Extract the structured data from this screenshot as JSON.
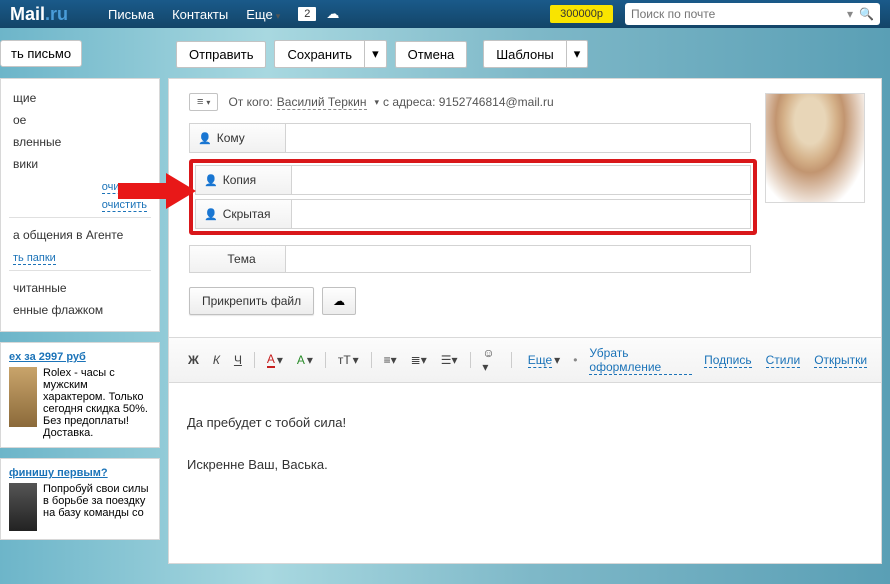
{
  "topnav": {
    "logo_a": "Mail",
    "logo_b": ".ru",
    "links": [
      "Письма",
      "Контакты",
      "Еще"
    ],
    "notif_count": "2",
    "money": "300000р",
    "search_placeholder": "Поиск по почте"
  },
  "toolbar": {
    "write": "ть письмо",
    "send": "Отправить",
    "save": "Сохранить",
    "cancel": "Отмена",
    "templates": "Шаблоны"
  },
  "sidebar": {
    "folders": [
      "щие",
      "ое",
      "вленные",
      "вики"
    ],
    "clear": "очистить",
    "agent": "а общения в Агенте",
    "folders_link": "ть папки",
    "unread": "читанные",
    "flagged": "енные флажком"
  },
  "ads": {
    "ad1_title": "ex за 2997 руб",
    "ad1_text": "Rolex - часы с\nмужским\nхарактером. Только\nсегодня скидка 50%.\nБез предоплаты!\nДоставка.",
    "ad2_title": "финишу первым?",
    "ad2_text": "Попробуй свои силы\nв борьбе за поездку\nна базу команды со"
  },
  "compose": {
    "from_label": "От кого:",
    "from_name": "Василий Теркин",
    "from_suffix": "с адреса:",
    "from_email": "9152746814@mail.ru",
    "to_label": "Кому",
    "cc_label": "Копия",
    "bcc_label": "Скрытая",
    "subject_label": "Тема",
    "attach": "Прикрепить файл"
  },
  "editor": {
    "bold": "Ж",
    "italic": "К",
    "underline": "Ч",
    "font_color": "A",
    "bg_color": "A",
    "size": "тT",
    "more": "Еще",
    "remove_fmt": "Убрать оформление",
    "signature": "Подпись",
    "styles": "Стили",
    "cards": "Открытки"
  },
  "body": {
    "line1": "Да пребудет с тобой сила!",
    "line2": "Искренне Ваш, Васька."
  }
}
